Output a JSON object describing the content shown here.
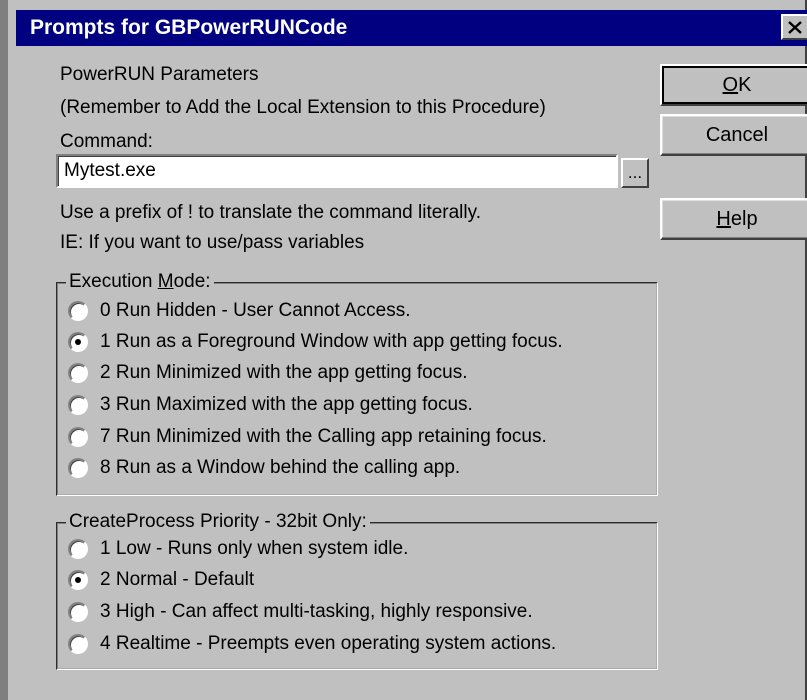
{
  "window": {
    "title": "Prompts for GBPowerRUNCode"
  },
  "header": {
    "line1": "PowerRUN Parameters",
    "line2": "(Remember to Add the Local Extension to this Procedure)",
    "command_label": "Command:"
  },
  "command": {
    "value": "Mytest.exe",
    "browse_label": "..."
  },
  "hints": {
    "line1": "Use a prefix of ! to translate the command literally.",
    "line2": "IE: If you want to use/pass variables"
  },
  "buttons": {
    "ok_mnemonic": "O",
    "ok_rest": "K",
    "cancel": "Cancel",
    "help_mnemonic": "H",
    "help_rest": "elp"
  },
  "execution_mode": {
    "legend_before": "Execution ",
    "legend_mnemonic": "M",
    "legend_after": "ode:",
    "options": [
      {
        "label": "0 Run Hidden - User Cannot Access.",
        "checked": false
      },
      {
        "label": "1 Run as a Foreground Window with app getting focus.",
        "checked": true
      },
      {
        "label": "2 Run Minimized with the app getting focus.",
        "checked": false
      },
      {
        "label": "3 Run Maximized with the app getting focus.",
        "checked": false
      },
      {
        "label": "7 Run Minimized with the Calling app retaining focus.",
        "checked": false
      },
      {
        "label": "8 Run as a Window behind the calling app.",
        "checked": false
      }
    ]
  },
  "priority": {
    "legend": "CreateProcess Priority - 32bit Only:",
    "options": [
      {
        "label": "1 Low - Runs only when system idle.",
        "checked": false
      },
      {
        "label": "2 Normal - Default",
        "checked": true
      },
      {
        "label": "3 High - Can affect multi-tasking, highly responsive.",
        "checked": false
      },
      {
        "label": "4 Realtime - Preempts even operating system actions.",
        "checked": false
      }
    ]
  }
}
